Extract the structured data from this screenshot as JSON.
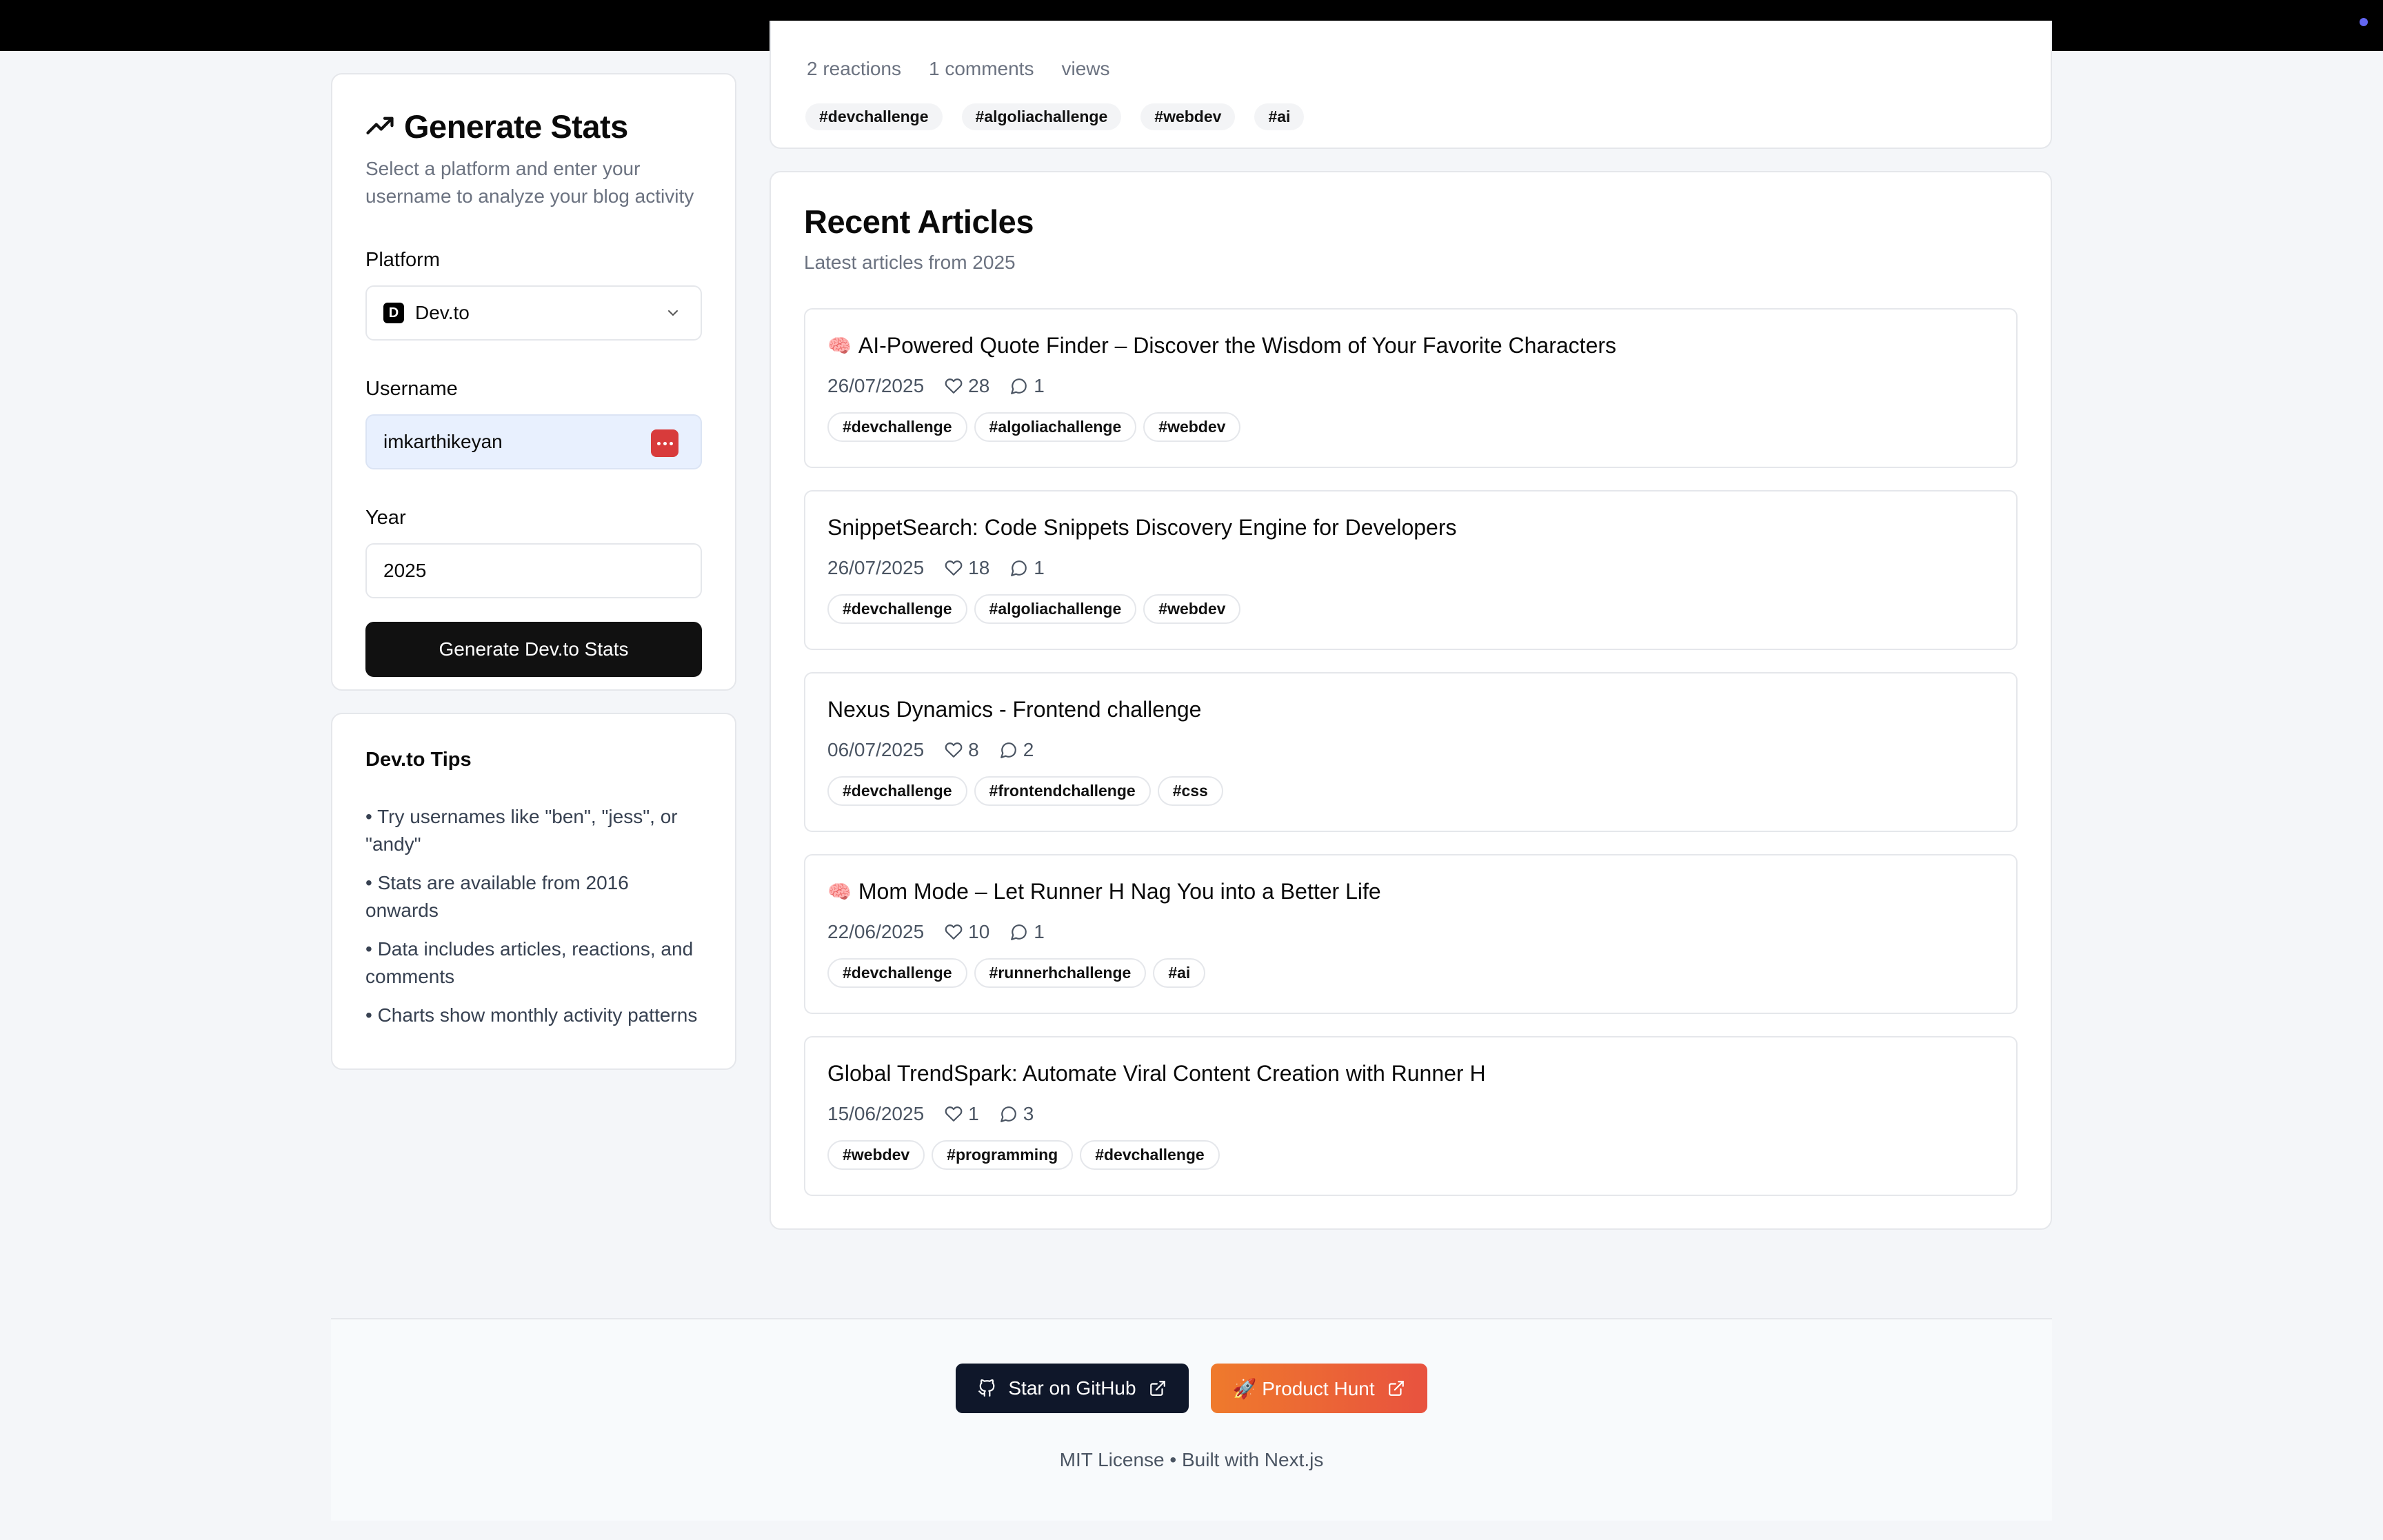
{
  "sidebar": {
    "title": "Generate Stats",
    "subtitle": "Select a platform and enter your username to analyze your blog activity",
    "platform_label": "Platform",
    "platform_value": "Dev.to",
    "platform_logo": "D",
    "username_label": "Username",
    "username_value": "imkarthikeyan",
    "year_label": "Year",
    "year_value": "2025",
    "submit_label": "Generate Dev.to Stats"
  },
  "tips": {
    "title": "Dev.to Tips",
    "items": [
      "• Try usernames like \"ben\", \"jess\", or \"andy\"",
      "• Stats are available from 2016 onwards",
      "• Data includes articles, reactions, and comments",
      "• Charts show monthly activity patterns"
    ]
  },
  "previous_card": {
    "meta": [
      "2 reactions",
      "1 comments",
      "views"
    ],
    "tags": [
      "#devchallenge",
      "#algoliachallenge",
      "#webdev",
      "#ai"
    ]
  },
  "recent": {
    "title": "Recent Articles",
    "subtitle": "Latest articles from 2025",
    "articles": [
      {
        "emoji": "🧠",
        "title": "AI-Powered Quote Finder – Discover the Wisdom of Your Favorite Characters",
        "date": "26/07/2025",
        "reactions": "28",
        "comments": "1",
        "tags": [
          "#devchallenge",
          "#algoliachallenge",
          "#webdev"
        ]
      },
      {
        "emoji": "",
        "title": "SnippetSearch: Code Snippets Discovery Engine for Developers",
        "date": "26/07/2025",
        "reactions": "18",
        "comments": "1",
        "tags": [
          "#devchallenge",
          "#algoliachallenge",
          "#webdev"
        ]
      },
      {
        "emoji": "",
        "title": "Nexus Dynamics - Frontend challenge",
        "date": "06/07/2025",
        "reactions": "8",
        "comments": "2",
        "tags": [
          "#devchallenge",
          "#frontendchallenge",
          "#css"
        ]
      },
      {
        "emoji": "🧠",
        "title": "Mom Mode – Let Runner H Nag You into a Better Life",
        "date": "22/06/2025",
        "reactions": "10",
        "comments": "1",
        "tags": [
          "#devchallenge",
          "#runnerhchallenge",
          "#ai"
        ]
      },
      {
        "emoji": "",
        "title": "Global TrendSpark: Automate Viral Content Creation with Runner H",
        "date": "15/06/2025",
        "reactions": "1",
        "comments": "3",
        "tags": [
          "#webdev",
          "#programming",
          "#devchallenge"
        ]
      }
    ]
  },
  "footer": {
    "github_label": "Star on GitHub",
    "producthunt_label": "🚀 Product Hunt",
    "text": "MIT License • Built with Next.js"
  },
  "colors": {
    "accent_dark": "#111111",
    "producthunt": "#e8523f",
    "github": "#0f172a"
  }
}
